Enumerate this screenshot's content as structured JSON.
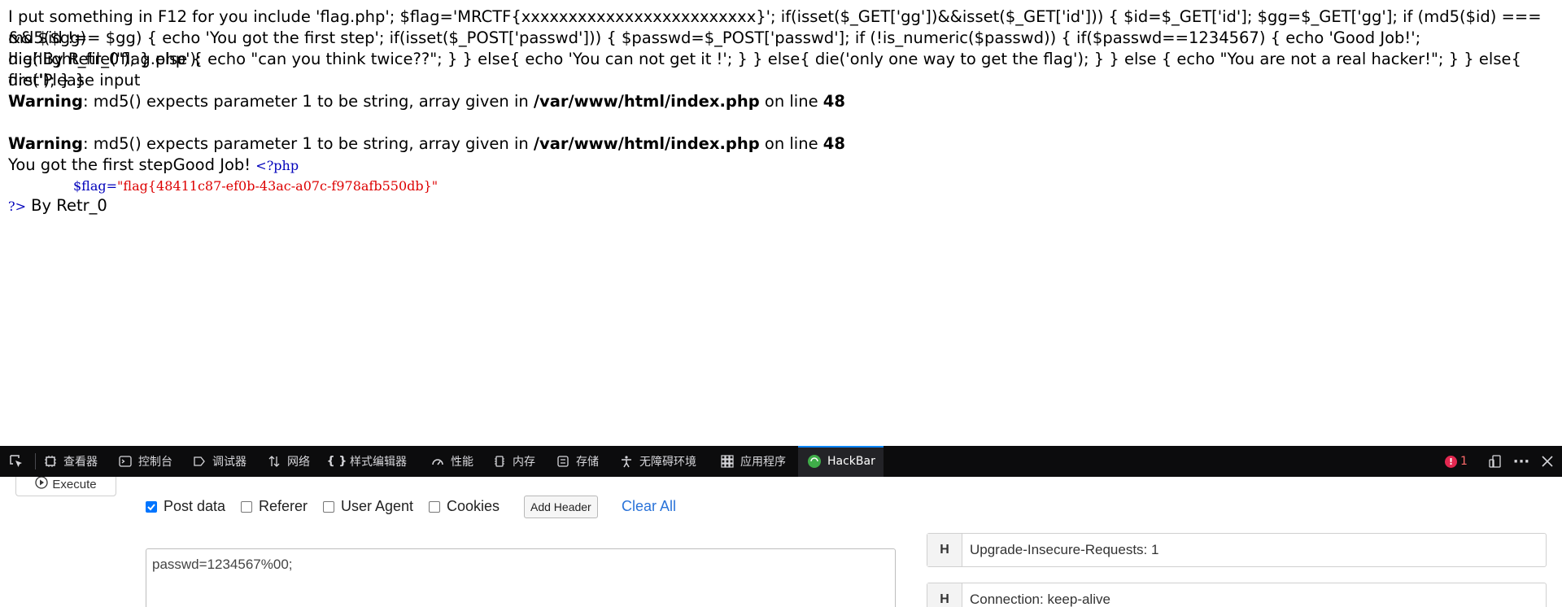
{
  "page": {
    "line1": "I put something in F12 for you include 'flag.php'; $flag='MRCTF{xxxxxxxxxxxxxxxxxxxxxxxxx}'; if(isset($_GET['gg'])&&isset($_GET['id'])) { $id=$_GET['id']; $gg=$_GET['gg']; if (md5($id) === md5($gg)",
    "line2": "&& $id !== $gg) { echo 'You got the first step'; if(isset($_POST['passwd'])) { $passwd=$_POST['passwd']; if (!is_numeric($passwd)) { if($passwd==1234567) { echo 'Good Job!'; highlight_file('flag.php');",
    "line3": "die('By Retr_0'); } else { echo \"can you think twice??\"; } } else{ echo 'You can not get it !'; } } else{ die('only one way to get the flag'); } } else { echo \"You are not a real hacker!\"; } } else{ die('Please input",
    "line4": "first'); } }",
    "warning1": {
      "label": "Warning",
      "text": ": md5() expects parameter 1 to be string, array given in ",
      "path": "/var/www/html/index.php",
      "on_line": " on line ",
      "line_no": "48"
    },
    "warning2": {
      "label": "Warning",
      "text": ": md5() expects parameter 1 to be string, array given in ",
      "path": "/var/www/html/index.php",
      "on_line": " on line ",
      "line_no": "48"
    },
    "result_text": "You got the first stepGood Job! ",
    "php_open": "<?php",
    "flag_var": "$flag=",
    "flag_value": "\"flag{48411c87-ef0b-43ac-a07c-f978afb550db}\"",
    "php_close": "?>",
    "by_text": " By Retr_0"
  },
  "devtools": {
    "tabs": [
      {
        "label": "查看器",
        "icon": "inspector-icon"
      },
      {
        "label": "控制台",
        "icon": "console-icon"
      },
      {
        "label": "调试器",
        "icon": "debugger-icon"
      },
      {
        "label": "网络",
        "icon": "network-icon"
      },
      {
        "label": "样式编辑器",
        "icon": "style-editor-icon"
      },
      {
        "label": "性能",
        "icon": "performance-icon"
      },
      {
        "label": "内存",
        "icon": "memory-icon"
      },
      {
        "label": "存储",
        "icon": "storage-icon"
      },
      {
        "label": "无障碍环境",
        "icon": "accessibility-icon"
      },
      {
        "label": "应用程序",
        "icon": "application-icon"
      },
      {
        "label": "HackBar",
        "icon": "hackbar-icon"
      }
    ],
    "error_count": "1"
  },
  "hackbar": {
    "execute_label": "Execute",
    "options": [
      {
        "label": "Post data",
        "checked": true
      },
      {
        "label": "Referer",
        "checked": false
      },
      {
        "label": "User Agent",
        "checked": false
      },
      {
        "label": "Cookies",
        "checked": false
      }
    ],
    "add_header_label": "Add Header",
    "clear_all_label": "Clear All",
    "post_body": "passwd=1234567%00;",
    "headers": [
      {
        "key": "H",
        "value": "Upgrade-Insecure-Requests: 1"
      },
      {
        "key": "H",
        "value": "Connection: keep-alive"
      }
    ]
  },
  "colors": {
    "accent": "#0a84ff",
    "devtools_bg": "#0c0c0d",
    "php_keyword": "#0000bb",
    "php_string": "#dd0000",
    "link": "#2a73d9"
  }
}
